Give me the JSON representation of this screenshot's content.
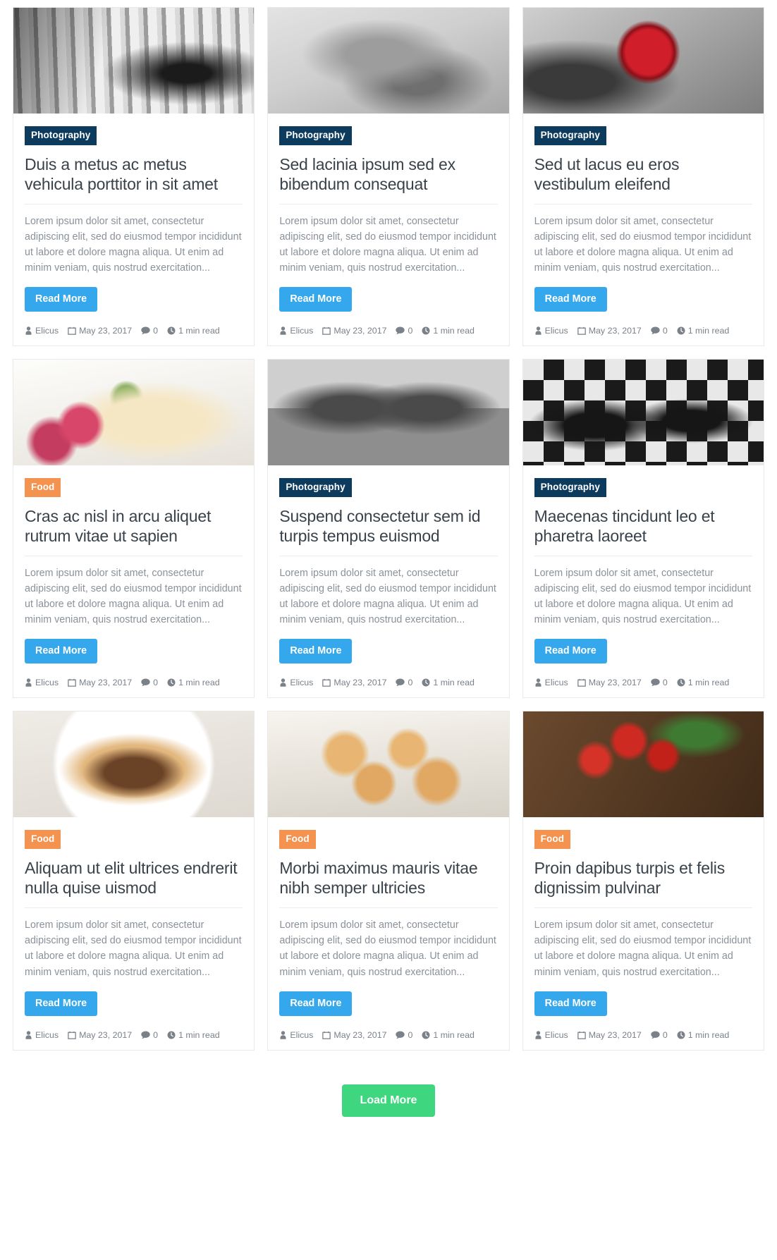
{
  "labels": {
    "read_more": "Read More",
    "load_more": "Load More"
  },
  "colors": {
    "category_photography": "#0d3b5e",
    "category_food": "#f4924f",
    "read_more_button": "#35a7ec",
    "load_more_button": "#3ed67e",
    "title_text": "#39424a",
    "excerpt_text": "#8a9199",
    "meta_text": "#7b8189",
    "card_border": "#e9e9e9"
  },
  "columns": [
    {
      "cards": [
        {
          "image": "snow-street-person-black-and-white-photo",
          "category": "Photography",
          "category_type": "photography",
          "title": "Duis a metus ac metus vehicula porttitor in sit amet",
          "excerpt": "Lorem ipsum dolor sit amet, consectetur adipiscing elit, sed do eiusmod tempor incididunt ut labore et dolore magna aliqua. Ut enim ad minim veniam, quis nostrud exercitation...",
          "meta": {
            "author": "Elicus",
            "date": "May 23, 2017",
            "comments": "0",
            "read_time": "1 min read"
          }
        },
        {
          "image": "raspberry-pancake-dessert-photo",
          "category": "Food",
          "category_type": "food",
          "title": "Cras ac nisl in arcu aliquet rutrum vitae ut sapien",
          "excerpt": "Lorem ipsum dolor sit amet, consectetur adipiscing elit, sed do eiusmod tempor incididunt ut labore et dolore magna aliqua. Ut enim ad minim veniam, quis nostrud exercitation...",
          "meta": {
            "author": "Elicus",
            "date": "May 23, 2017",
            "comments": "0",
            "read_time": "1 min read"
          }
        },
        {
          "image": "chocolate-pancake-banana-plate-photo",
          "category": "Food",
          "category_type": "food",
          "title": "Aliquam ut elit ultrices endrerit nulla quise uismod",
          "excerpt": "Lorem ipsum dolor sit amet, consectetur adipiscing elit, sed do eiusmod tempor incididunt ut labore et dolore magna aliqua. Ut enim ad minim veniam, quis nostrud exercitation...",
          "meta": {
            "author": "Elicus",
            "date": "May 23, 2017",
            "comments": "0",
            "read_time": "1 min read"
          }
        }
      ]
    },
    {
      "cards": [
        {
          "image": "lion-cub-black-and-white-photo",
          "category": "Photography",
          "category_type": "photography",
          "title": "Sed lacinia ipsum sed ex bibendum consequat",
          "excerpt": "Lorem ipsum dolor sit amet, consectetur adipiscing elit, sed do eiusmod tempor incididunt ut labore et dolore magna aliqua. Ut enim ad minim veniam, quis nostrud exercitation...",
          "meta": {
            "author": "Elicus",
            "date": "May 23, 2017",
            "comments": "0",
            "read_time": "1 min read"
          }
        },
        {
          "image": "two-pugs-black-and-white-photo",
          "category": "Photography",
          "category_type": "photography",
          "title": "Suspend consectetur sem id turpis tempus euismod",
          "excerpt": "Lorem ipsum dolor sit amet, consectetur adipiscing elit, sed do eiusmod tempor incididunt ut labore et dolore magna aliqua. Ut enim ad minim veniam, quis nostrud exercitation...",
          "meta": {
            "author": "Elicus",
            "date": "May 23, 2017",
            "comments": "0",
            "read_time": "1 min read"
          }
        },
        {
          "image": "pinwheel-pastry-rolls-plate-photo",
          "category": "Food",
          "category_type": "food",
          "title": "Morbi maximus mauris vitae nibh semper ultricies",
          "excerpt": "Lorem ipsum dolor sit amet, consectetur adipiscing elit, sed do eiusmod tempor incididunt ut labore et dolore magna aliqua. Ut enim ad minim veniam, quis nostrud exercitation...",
          "meta": {
            "author": "Elicus",
            "date": "May 23, 2017",
            "comments": "0",
            "read_time": "1 min read"
          }
        }
      ]
    },
    {
      "cards": [
        {
          "image": "red-apple-on-tree-selective-color-photo",
          "category": "Photography",
          "category_type": "photography",
          "title": "Sed ut lacus eu eros vestibulum eleifend",
          "excerpt": "Lorem ipsum dolor sit amet, consectetur adipiscing elit, sed do eiusmod tempor incididunt ut labore et dolore magna aliqua. Ut enim ad minim veniam, quis nostrud exercitation...",
          "meta": {
            "author": "Elicus",
            "date": "May 23, 2017",
            "comments": "0",
            "read_time": "1 min read"
          }
        },
        {
          "image": "chess-board-pieces-photo",
          "category": "Photography",
          "category_type": "photography",
          "title": "Maecenas tincidunt leo et pharetra laoreet",
          "excerpt": "Lorem ipsum dolor sit amet, consectetur adipiscing elit, sed do eiusmod tempor incididunt ut labore et dolore magna aliqua. Ut enim ad minim veniam, quis nostrud exercitation...",
          "meta": {
            "author": "Elicus",
            "date": "May 23, 2017",
            "comments": "0",
            "read_time": "1 min read"
          }
        },
        {
          "image": "tomatoes-basil-wooden-table-photo",
          "category": "Food",
          "category_type": "food",
          "title": "Proin dapibus turpis et felis dignissim pulvinar",
          "excerpt": "Lorem ipsum dolor sit amet, consectetur adipiscing elit, sed do eiusmod tempor incididunt ut labore et dolore magna aliqua. Ut enim ad minim veniam, quis nostrud exercitation...",
          "meta": {
            "author": "Elicus",
            "date": "May 23, 2017",
            "comments": "0",
            "read_time": "1 min read"
          }
        }
      ]
    }
  ]
}
